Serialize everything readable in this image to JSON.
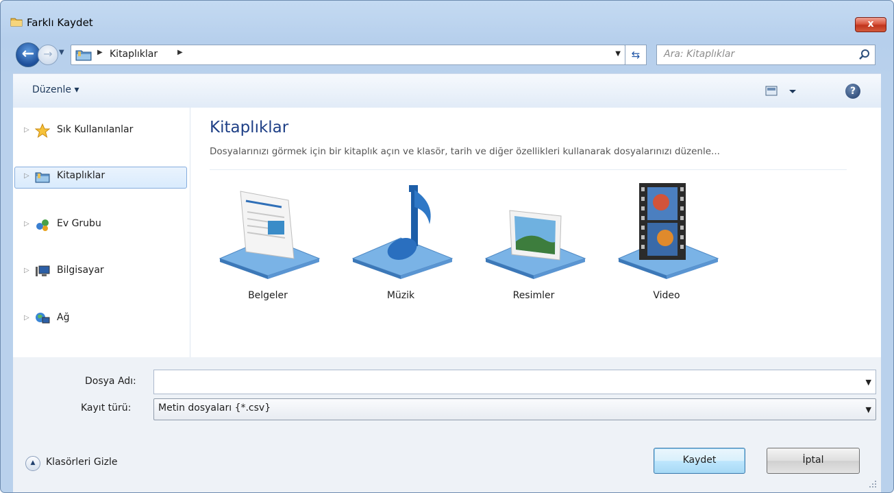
{
  "window": {
    "title": "Farklı Kaydet",
    "close_label": "x"
  },
  "nav": {
    "breadcrumb": [
      "Kitaplıklar"
    ],
    "search_placeholder": "Ara: Kitaplıklar",
    "back_glyph": "←",
    "refresh_glyph": "⇆"
  },
  "toolbar": {
    "organize_label": "Düzenle ▾",
    "help_glyph": "?"
  },
  "sidebar": {
    "items": [
      {
        "label": "Sık Kullanılanlar",
        "icon": "star-icon"
      },
      {
        "label": "Kitaplıklar",
        "icon": "libraries-icon",
        "selected": true
      },
      {
        "label": "Ev Grubu",
        "icon": "homegroup-icon"
      },
      {
        "label": "Bilgisayar",
        "icon": "computer-icon"
      },
      {
        "label": "Ağ",
        "icon": "network-icon"
      }
    ]
  },
  "main": {
    "title": "Kitaplıklar",
    "description": "Dosyalarınızı görmek için bir kitaplık açın ve klasör, tarih ve diğer özellikleri kullanarak dosyalarınızı düzenle...",
    "libraries": [
      {
        "label": "Belgeler",
        "icon": "documents-library-icon"
      },
      {
        "label": "Müzik",
        "icon": "music-library-icon"
      },
      {
        "label": "Resimler",
        "icon": "pictures-library-icon"
      },
      {
        "label": "Video",
        "icon": "videos-library-icon"
      }
    ]
  },
  "form": {
    "filename_label": "Dosya Adı:",
    "filename_value": "",
    "filetype_label": "Kayıt türü:",
    "filetype_value": "Metin dosyaları {*.csv}",
    "hide_folders_label": "Klasörleri Gizle",
    "save_label": "Kaydet",
    "cancel_label": "İptal"
  },
  "colors": {
    "accent": "#1e3f86",
    "frame": "#b9d1ec",
    "close": "#c7432b"
  }
}
